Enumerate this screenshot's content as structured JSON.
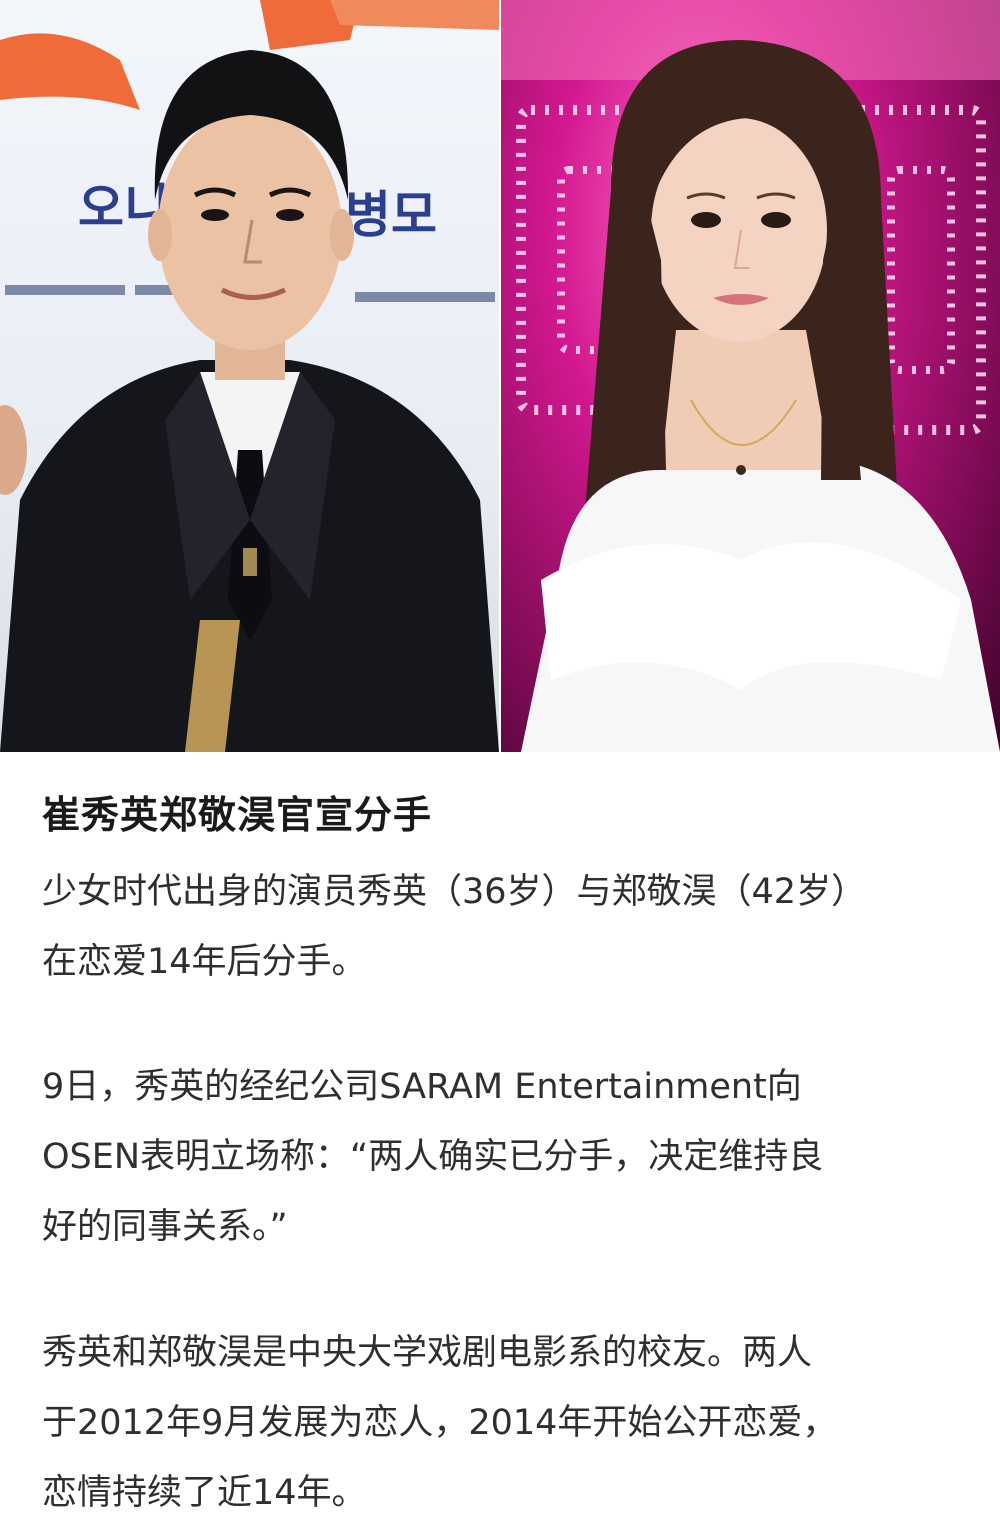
{
  "images": {
    "left": {
      "subject": "man in dark suit at event",
      "backdrop_text_1": "오니",
      "backdrop_text_2": "병모"
    },
    "right": {
      "subject": "woman in white off-shoulder dress in front of pink lights"
    }
  },
  "article": {
    "headline": "崔秀英郑敬淏官宣分手",
    "paragraph_1_line_1": "少女时代出身的演员秀英（36岁）与郑敬淏（42岁）",
    "paragraph_1_line_2": "在恋爱14年后分手。",
    "paragraph_2_line_1": "9日，秀英的经纪公司SARAM Entertainment向",
    "paragraph_2_line_2": "OSEN表明立场称：“两人确实已分手，决定维持良",
    "paragraph_2_line_3": "好的同事关系。”",
    "paragraph_3_line_1": "秀英和郑敬淏是中央大学戏剧电影系的校友。两人",
    "paragraph_3_line_2": "于2012年9月发展为恋人，2014年开始公开恋爱，",
    "paragraph_3_line_3": "恋情持续了近14年。"
  },
  "colors": {
    "text": "#2f2f2f",
    "headline": "#1a1a1a",
    "background": "#ffffff",
    "pink_accent": "#d3188f"
  }
}
